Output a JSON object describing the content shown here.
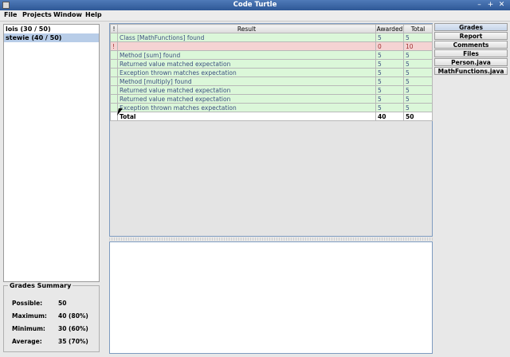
{
  "window": {
    "title": "Code Turtle",
    "buttons": [
      "–",
      "+",
      "✕"
    ]
  },
  "menu": [
    "File",
    "Projects",
    "Window",
    "Help"
  ],
  "students": [
    {
      "label": "lois (30 / 50)",
      "selected": false
    },
    {
      "label": "stewie (40 / 50)",
      "selected": true
    }
  ],
  "summary": {
    "title": "Grades Summary",
    "rows": [
      {
        "label": "Possible:",
        "value": "50"
      },
      {
        "label": "Maximum:",
        "value": "40 (80%)"
      },
      {
        "label": "Minimum:",
        "value": "30 (60%)"
      },
      {
        "label": "Average:",
        "value": "35 (70%)"
      }
    ]
  },
  "results": {
    "headers": [
      "!",
      "Result",
      "Awarded",
      "Total"
    ],
    "rows": [
      {
        "flag": "",
        "result": "Class [MathFunctions] found",
        "awarded": "5",
        "total": "5",
        "status": "ok"
      },
      {
        "flag": "!",
        "result": "",
        "awarded": "0",
        "total": "10",
        "status": "fail"
      },
      {
        "flag": "",
        "result": "Method [sum] found",
        "awarded": "5",
        "total": "5",
        "status": "ok"
      },
      {
        "flag": "",
        "result": "Returned value matched expectation",
        "awarded": "5",
        "total": "5",
        "status": "ok"
      },
      {
        "flag": "",
        "result": "Exception thrown matches expectation",
        "awarded": "5",
        "total": "5",
        "status": "ok"
      },
      {
        "flag": "",
        "result": "Method [multiply] found",
        "awarded": "5",
        "total": "5",
        "status": "ok"
      },
      {
        "flag": "",
        "result": "Returned value matched expectation",
        "awarded": "5",
        "total": "5",
        "status": "ok"
      },
      {
        "flag": "",
        "result": "Returned value matched expectation",
        "awarded": "5",
        "total": "5",
        "status": "ok"
      },
      {
        "flag": "",
        "result": "Exception thrown matches expectation",
        "awarded": "5",
        "total": "5",
        "status": "ok"
      },
      {
        "flag": "",
        "result": "Total",
        "awarded": "40",
        "total": "50",
        "status": "total"
      }
    ]
  },
  "tabs": [
    {
      "label": "Grades",
      "active": true
    },
    {
      "label": "Report",
      "active": false
    },
    {
      "label": "Comments",
      "active": false
    },
    {
      "label": "Files",
      "active": false
    },
    {
      "label": "Person.java",
      "active": false
    },
    {
      "label": "MathFunctions.java",
      "active": false
    }
  ],
  "colors": {
    "titlebar": "#3a66a6",
    "ok_row": "#dbf7d9",
    "fail_row": "#f5d3d3",
    "selection": "#b8cde8"
  }
}
